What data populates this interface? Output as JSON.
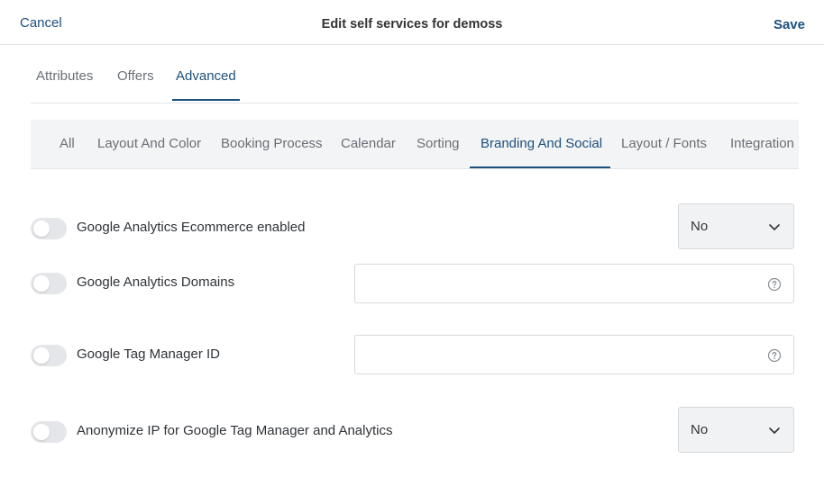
{
  "header": {
    "cancel_label": "Cancel",
    "title": "Edit self services for demoss",
    "save_label": "Save"
  },
  "tabs": [
    {
      "label": "Attributes"
    },
    {
      "label": "Offers"
    },
    {
      "label": "Advanced",
      "active": true
    }
  ],
  "subtabs": [
    {
      "label": "All"
    },
    {
      "label": "Layout And Color"
    },
    {
      "label": "Booking Process"
    },
    {
      "label": "Calendar"
    },
    {
      "label": "Sorting"
    },
    {
      "label": "Branding And Social",
      "active": true
    },
    {
      "label": "Layout / Fonts"
    },
    {
      "label": "Integration"
    }
  ],
  "settings": {
    "ga_ecommerce": {
      "label": "Google Analytics Ecommerce enabled",
      "toggle_on": false,
      "value": "No"
    },
    "ga_domains": {
      "label": "Google Analytics Domains",
      "toggle_on": false,
      "value": ""
    },
    "gtm_id": {
      "label": "Google Tag Manager ID",
      "toggle_on": false,
      "value": ""
    },
    "anonymize_ip": {
      "label": "Anonymize IP for Google Tag Manager and Analytics",
      "toggle_on": false,
      "value": "No"
    }
  },
  "icons": {
    "chevron": "chevron-down-icon",
    "help": "help-circle-icon"
  },
  "colors": {
    "accent": "#1d4f7c",
    "muted_text": "#6a6f75",
    "toggle_off": "#e4e6e9",
    "select_bg": "#f1f2f4"
  }
}
